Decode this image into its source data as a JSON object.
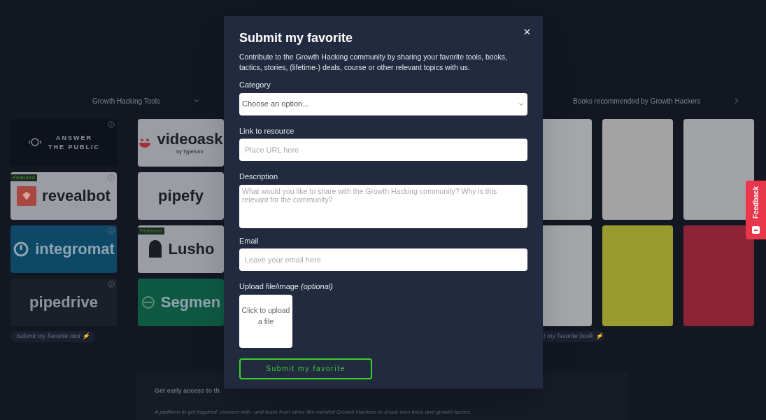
{
  "tools": {
    "title": "Growth Hacking Tools",
    "columns": [
      [
        {
          "lines": [
            "ANSWER",
            "THE PUBLIC"
          ],
          "color": "#0e121b",
          "info": true
        },
        {
          "lines": [
            "revealbot"
          ],
          "color": "#9a9da4",
          "badge": "Featured",
          "info": true
        },
        {
          "lines": [
            "integromat"
          ],
          "color": "#0d4966",
          "info": true
        },
        {
          "lines": [
            "pipedrive"
          ],
          "color": "#1a1f29",
          "info": true
        }
      ],
      [
        {
          "lines": [
            "videoask",
            "by Typeform"
          ],
          "color": "#9a9da4",
          "info": false
        },
        {
          "lines": [
            "pipefy"
          ],
          "color": "#9a9da4",
          "info": false
        },
        {
          "lines": [
            "Lusho"
          ],
          "color": "#9a9da4",
          "badge": "Featured",
          "info": false
        },
        {
          "lines": [
            "Segmen"
          ],
          "color": "#0f5943",
          "info": false
        }
      ]
    ],
    "submit_link": "Submit my favorite tool ⚡"
  },
  "books": {
    "title": "Books recommended by Growth Hackers",
    "rows": [
      [
        {
          "color": "#a4a6a9"
        },
        {
          "color": "#a3a3a3"
        },
        {
          "color": "#a1a3a7"
        }
      ],
      [
        {
          "color": "#a3a5a8"
        },
        {
          "color": "#9a9b2e"
        },
        {
          "color": "#8b2434"
        }
      ]
    ],
    "submit_link": "t my favorite book ⚡"
  },
  "early_access": {
    "title": "Get early access to th",
    "text": "A platform to get inspired, connect with- and learn from other like-minded Growth Hackers to share new tools and growth tactics."
  },
  "feedback": {
    "label": "Feedback"
  },
  "modal": {
    "title": "Submit my favorite",
    "intro": "Contribute to the Growth Hacking community by sharing your favorite tools, books, tactics, stories, (lifetime-) deals, course or other relevant topics with us.",
    "fields": [
      {
        "kind": "select",
        "label": "Category",
        "placeholder": "Choose an option..."
      },
      {
        "kind": "input",
        "label": "Link to resource",
        "placeholder": "Place URL here"
      },
      {
        "kind": "textarea",
        "label": "Description",
        "placeholder": "What would you like to share with the Growth Hacking community? Why is this relevant for the community?"
      },
      {
        "kind": "input",
        "label": "Email",
        "placeholder": "Leave your email here"
      },
      {
        "kind": "upload",
        "label": "Upload file/image *(optional)*",
        "placeholder": "Click to upload a file"
      }
    ],
    "submit": "Submit my favorite"
  }
}
